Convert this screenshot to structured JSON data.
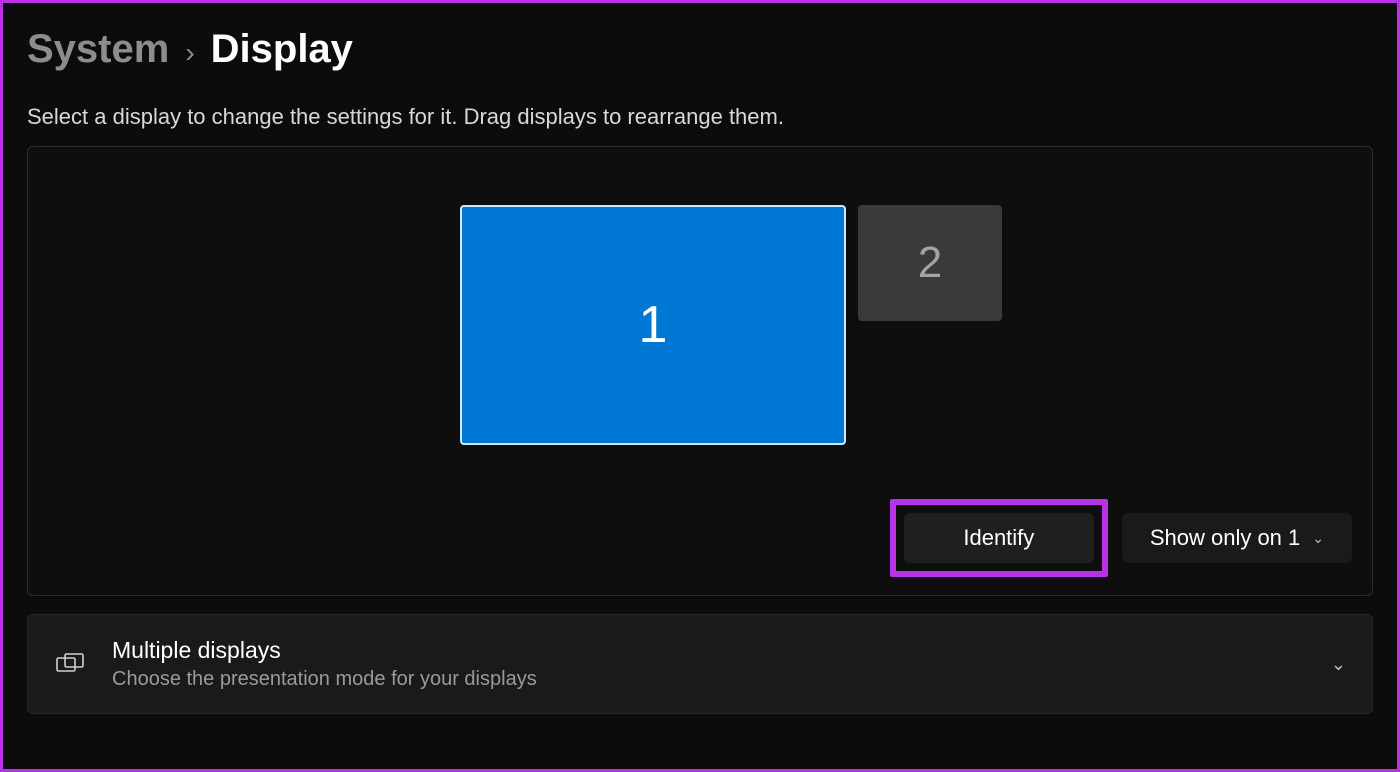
{
  "breadcrumb": {
    "parent": "System",
    "current": "Display"
  },
  "description": "Select a display to change the settings for it. Drag displays to rearrange them.",
  "displays": {
    "monitor1_label": "1",
    "monitor2_label": "2"
  },
  "buttons": {
    "identify": "Identify",
    "projection_mode": "Show only on 1"
  },
  "multiple_displays": {
    "title": "Multiple displays",
    "subtitle": "Choose the presentation mode for your displays"
  }
}
